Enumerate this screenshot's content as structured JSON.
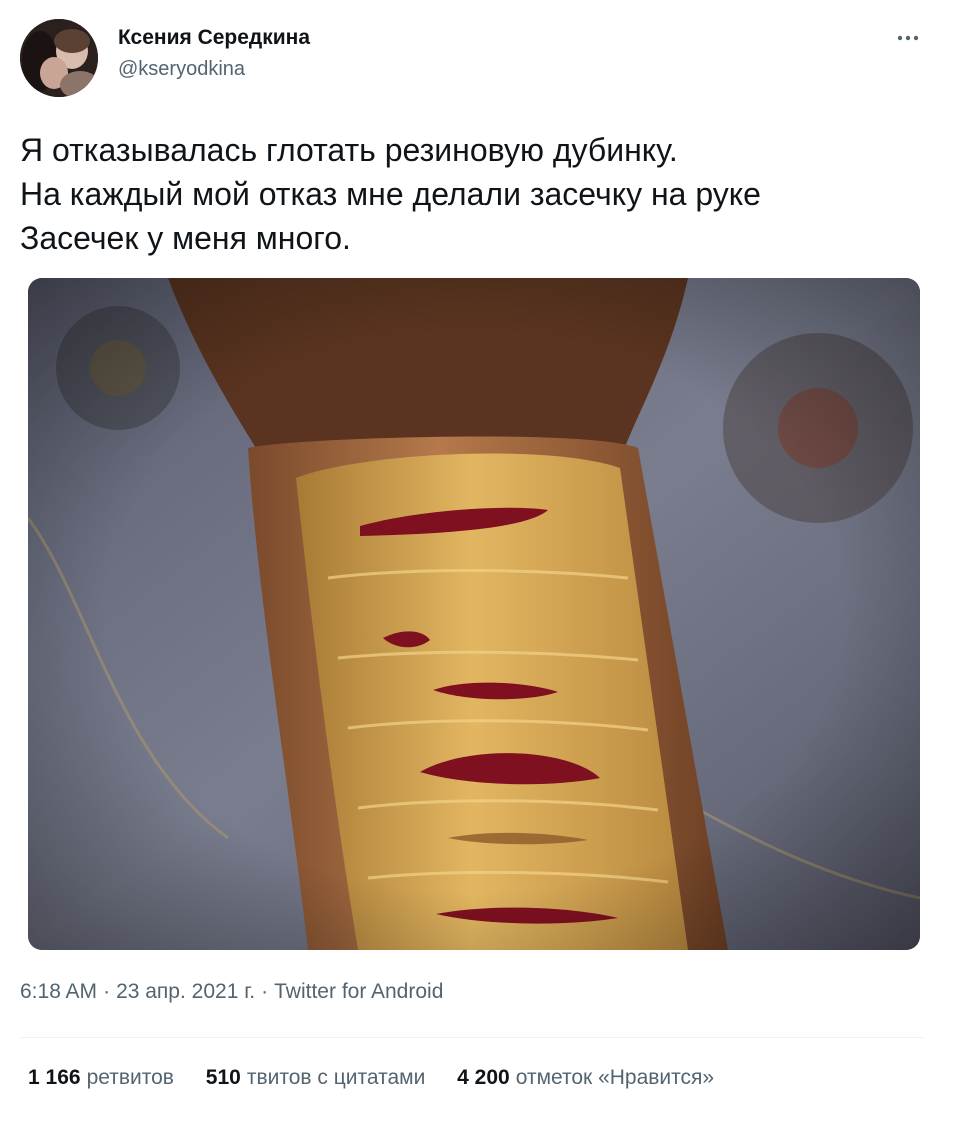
{
  "author": {
    "name": "Ксения Середкина",
    "handle": "@kseryodkina"
  },
  "tweet": {
    "lines": [
      "Я отказывалась глотать резиновую дубинку.",
      "На каждый мой отказ мне делали засечку на руке",
      "Засечек у меня много."
    ]
  },
  "meta": {
    "time": "6:18 AM",
    "date": "23 апр. 2021 г.",
    "source": "Twitter for Android",
    "separator": "·"
  },
  "stats": [
    {
      "number": "1 166",
      "label": "ретвитов"
    },
    {
      "number": "510",
      "label": "твитов с цитатами"
    },
    {
      "number": "4 200",
      "label": "отметок «Нравится»"
    }
  ],
  "icons": {
    "more": "more-horizontal-icon"
  },
  "colors": {
    "text": "#0f1419",
    "secondary": "#536471",
    "divider": "#eff3f4"
  }
}
